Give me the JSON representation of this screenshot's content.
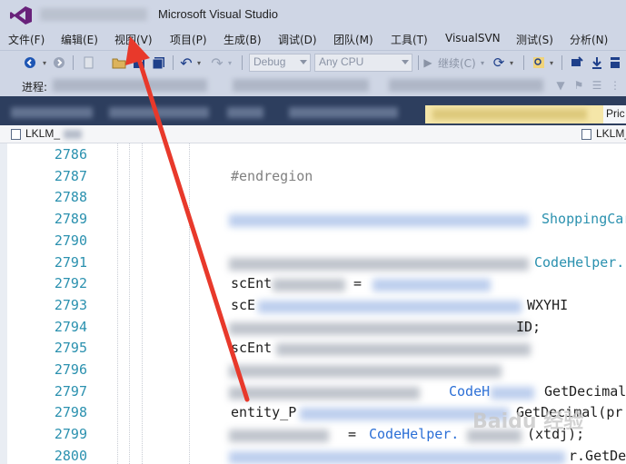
{
  "window": {
    "title": "Microsoft Visual Studio",
    "logo_icon": "visual-studio-logo"
  },
  "menu": [
    {
      "label": "文件(F)"
    },
    {
      "label": "编辑(E)"
    },
    {
      "label": "视图(V)"
    },
    {
      "label": "项目(P)"
    },
    {
      "label": "生成(B)"
    },
    {
      "label": "调试(D)"
    },
    {
      "label": "团队(M)"
    },
    {
      "label": "工具(T)"
    },
    {
      "label": "VisualSVN"
    },
    {
      "label": "测试(S)"
    },
    {
      "label": "分析(N)"
    }
  ],
  "toolbar": {
    "config_combo": "Debug",
    "platform_combo": "Any CPU",
    "continue_label": "继续(C)",
    "process_label": "进程:"
  },
  "tabs": {
    "right_tab_label": "Pric"
  },
  "navbar": {
    "left_label": "LKLM_",
    "right_label": "LKLM_"
  },
  "editor": {
    "line_numbers": [
      "2786",
      "2787",
      "2788",
      "2789",
      "2790",
      "2791",
      "2792",
      "2793",
      "2794",
      "2795",
      "2796",
      "2797",
      "2798",
      "2799",
      "2800"
    ],
    "code": {
      "l2787": "#endregion",
      "l2789_tail": "ShoppingCar",
      "l2791_tail": "CodeHelper.",
      "l2792_part": "scEnt",
      "l2792_eq": " = ",
      "l2793_head": "scE",
      "l2793_tail": "WXYHI",
      "l2794_tail": "ID;",
      "l2795_head": "scEnt",
      "l2797_mid": "CodeH",
      "l2797_tail": " GetDecimal",
      "l2798_head": "entity_P",
      "l2798_tail": "GetDecimal(pr",
      "l2799_eq": " = ",
      "l2799_mid": "CodeHelper.",
      "l2799_tail": "(xtdj);",
      "l2800_tail": "r.GetDec"
    }
  },
  "watermark": "Baidu 经验",
  "colors": {
    "chrome": "#cfd6e5",
    "tabstrip": "#2d3e5e",
    "active_tab": "#f5e6a8",
    "line_number": "#2b91af",
    "arrow": "#e8392b"
  }
}
